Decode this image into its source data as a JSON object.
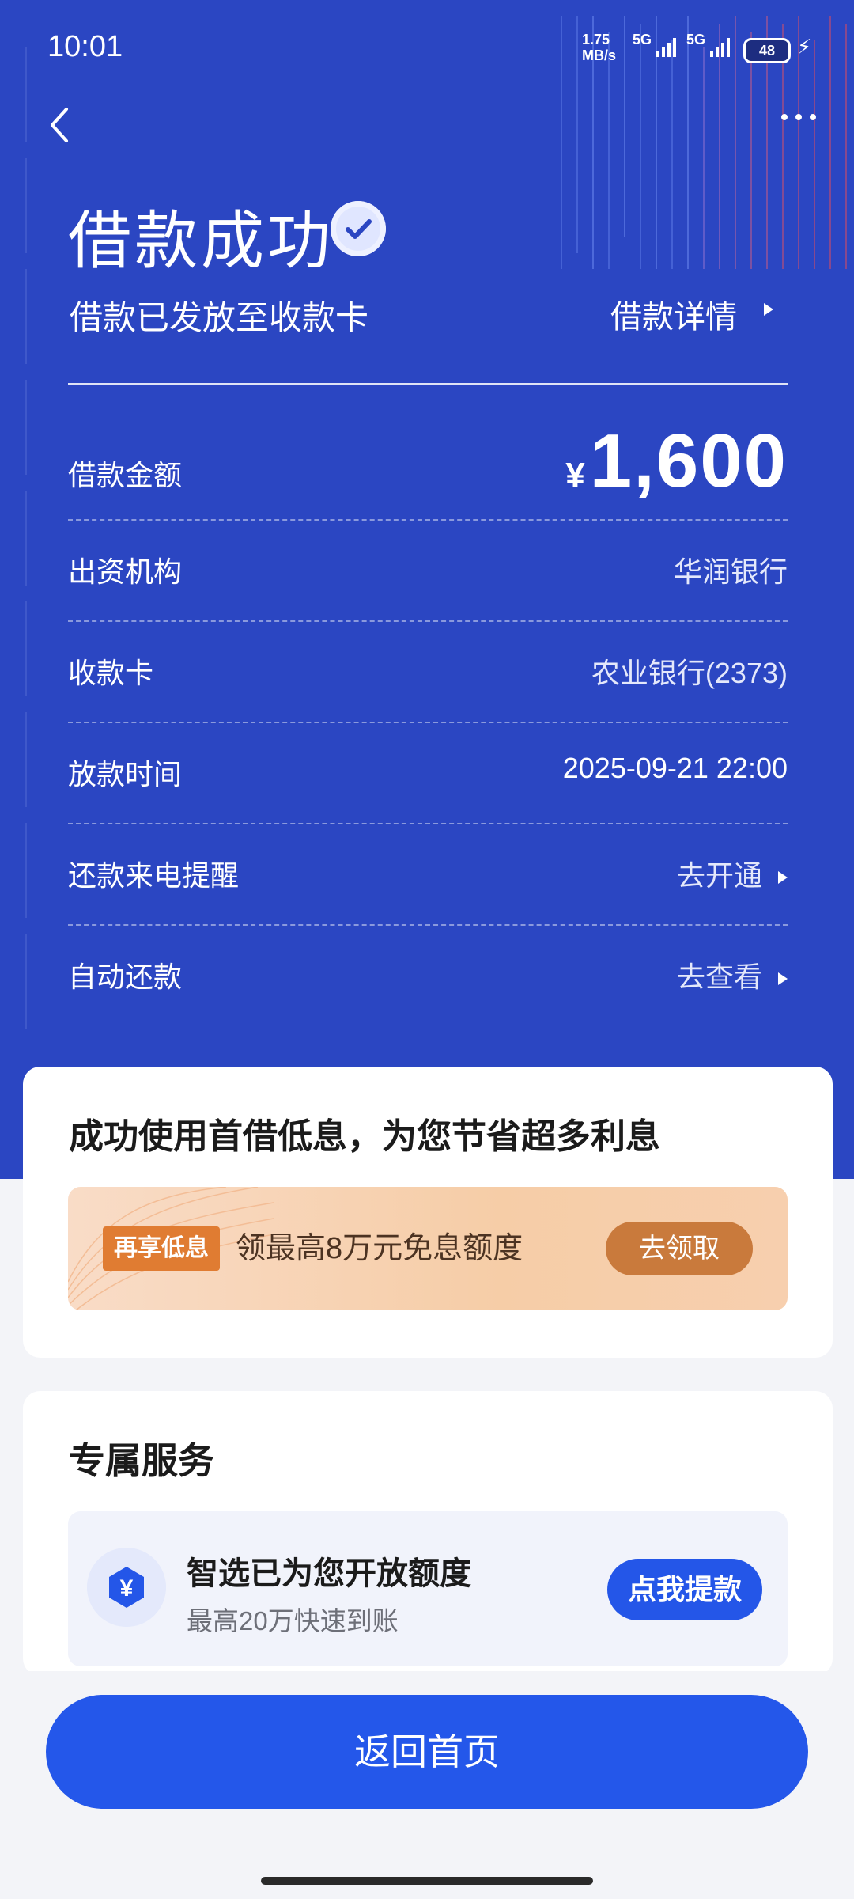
{
  "status_bar": {
    "time": "10:01",
    "net_speed_value": "1.75",
    "net_speed_unit": "MB/s",
    "sig1": "5G",
    "sig2": "5G",
    "battery": "48"
  },
  "header": {
    "title": "借款成功",
    "subtitle": "借款已发放至收款卡",
    "detail_link": "借款详情"
  },
  "rows": [
    {
      "label": "借款金额",
      "currency": "¥",
      "value": "1,600"
    },
    {
      "label": "出资机构",
      "value": "华润银行"
    },
    {
      "label": "收款卡",
      "value": "农业银行(2373)"
    },
    {
      "label": "放款时间",
      "value": "2025-09-21 22:00"
    },
    {
      "label": "还款来电提醒",
      "value": "去开通"
    },
    {
      "label": "自动还款",
      "value": "去查看"
    }
  ],
  "promo_card": {
    "heading": "成功使用首借低息，为您节省超多利息",
    "tag": "再享低息",
    "text": "领最高8万元免息额度",
    "button": "去领取"
  },
  "service_card": {
    "heading": "专属服务",
    "title": "智选已为您开放额度",
    "subtitle": "最高20万快速到账",
    "button": "点我提款",
    "icon_glyph": "¥"
  },
  "footer": {
    "home_button": "返回首页"
  },
  "colors": {
    "hero_bg": "#2b46c2",
    "primary_button": "#2457ea",
    "promo_button": "#c97a3c",
    "promo_tag": "#e07c32"
  }
}
